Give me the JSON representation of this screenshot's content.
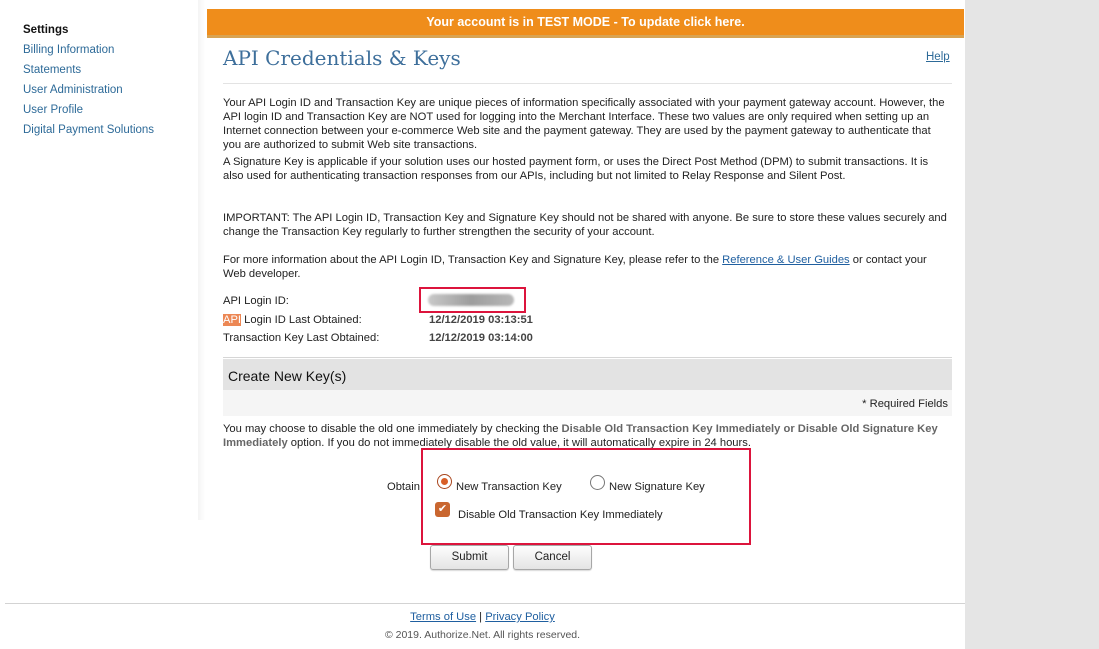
{
  "banner": "Your account is in TEST MODE - To update click here.",
  "sidebar": {
    "title": "Settings",
    "items": [
      {
        "label": "Billing Information"
      },
      {
        "label": "Statements"
      },
      {
        "label": "User Administration"
      },
      {
        "label": "User Profile"
      },
      {
        "label": "Digital Payment Solutions"
      }
    ]
  },
  "page": {
    "title": "API Credentials & Keys",
    "help": "Help",
    "paragraph1": "Your API Login ID and Transaction Key are unique pieces of information specifically associated with your payment gateway account. However, the API login ID and Transaction Key are NOT used for logging into the Merchant Interface. These two values are only required when setting up an Internet connection between your e-commerce Web site and the payment gateway. They are used by the payment gateway to authenticate that you are authorized to submit Web site transactions.",
    "paragraph2": "A Signature Key is applicable if your solution uses our hosted payment form, or uses the Direct Post Method (DPM) to submit transactions. It is also used for authenticating transaction responses from our APIs, including but not limited to Relay Response and Silent Post.",
    "paragraph3": "IMPORTANT: The API Login ID, Transaction Key and Signature Key should not be shared with anyone. Be sure to store these values securely and change the Transaction Key regularly to further strengthen the security of your account.",
    "paragraph4_pre": "For more information about the API Login ID, Transaction Key and Signature Key, please refer to the ",
    "paragraph4_link": "Reference & User Guides",
    "paragraph4_post": " or contact your Web developer."
  },
  "credentials": {
    "login_id_label": "API Login ID:",
    "login_obtained_label_hl": "API",
    "login_obtained_label_rest": " Login ID Last Obtained:",
    "login_obtained_value": "12/12/2019 03:13:51",
    "txkey_obtained_label": "Transaction Key Last Obtained:",
    "txkey_obtained_value": "12/12/2019 03:14:00"
  },
  "create": {
    "heading": "Create New Key(s)",
    "required_note": "* Required Fields",
    "info_pre": "You may choose to disable the old one immediately by checking the ",
    "info_bold": "Disable Old Transaction Key Immediately or Disable Old Signature Key Immediately",
    "info_post": " option. If you do not immediately disable the old value, it will automatically expire in 24 hours.",
    "obtain_label": "Obtain:",
    "option_new_transaction_key": "New Transaction Key",
    "option_new_signature_key": "New Signature Key",
    "selected_option": "New Transaction Key",
    "disable_old_label": "Disable Old Transaction Key Immediately",
    "disable_old_checked": true,
    "submit": "Submit",
    "cancel": "Cancel"
  },
  "footer": {
    "terms": "Terms of Use",
    "separator": "|",
    "privacy": "Privacy Policy",
    "copyright": "© 2019. Authorize.Net. All rights reserved."
  },
  "colors": {
    "banner": "#ef8d1b",
    "title": "#3e6f9b",
    "link": "#2d6a98",
    "annotation": "#dc143c",
    "radio_selected": "#d85f28"
  }
}
